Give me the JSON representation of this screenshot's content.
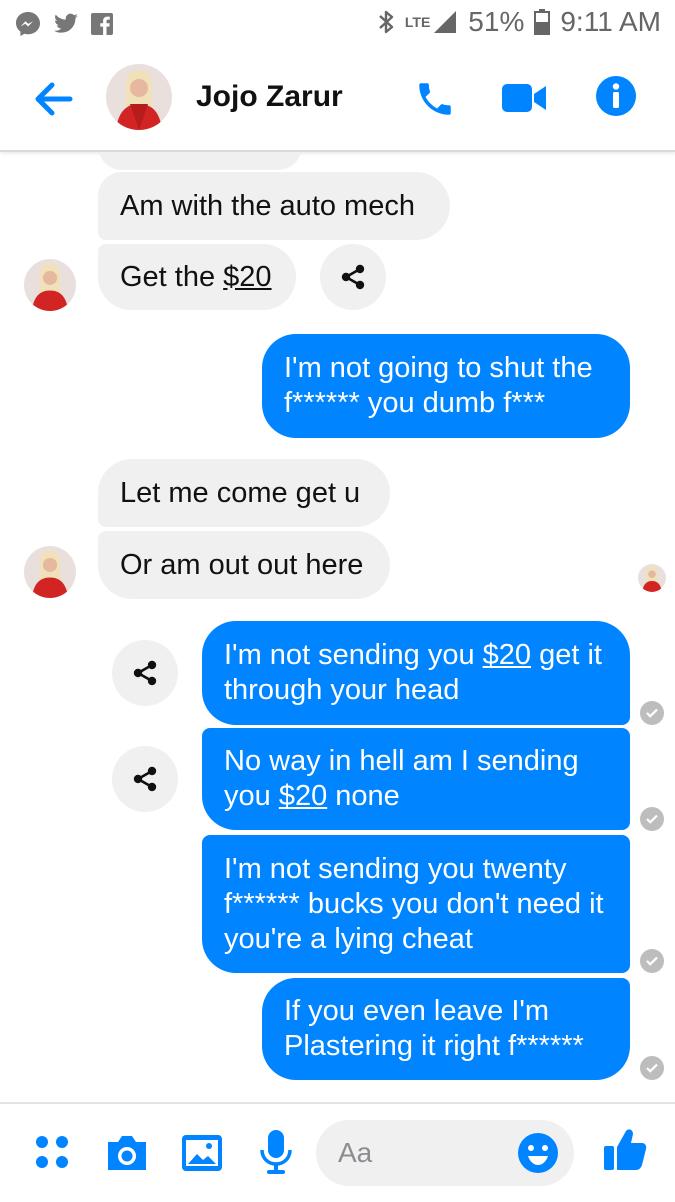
{
  "status_bar": {
    "network": "LTE",
    "battery": "51%",
    "time": "9:11 AM"
  },
  "header": {
    "contact_name": "Jojo Zarur"
  },
  "messages": [
    {
      "text": "Am with the auto mech"
    },
    {
      "pre": "Get the ",
      "link": "$20",
      "post": ""
    },
    {
      "text": "I'm not going to shut the f****** you dumb f***"
    },
    {
      "text": "Let me come get u"
    },
    {
      "text": "Or am out out here"
    },
    {
      "pre": "I'm not sending you ",
      "link": "$20",
      "post": " get it through your head"
    },
    {
      "pre": "No way in hell am I sending you ",
      "link": "$20",
      "post": " none"
    },
    {
      "text": "I'm not sending you twenty f****** bucks you don't need it you're a lying cheat"
    },
    {
      "text": "If you even leave I'm Plastering it right f******"
    }
  ],
  "composer": {
    "placeholder": "Aa"
  },
  "icons": {
    "status_left": [
      "messenger-icon",
      "twitter-icon",
      "facebook-icon"
    ],
    "status_right": [
      "bluetooth-icon",
      "signal-icon",
      "battery-icon"
    ],
    "header": [
      "back-arrow-icon",
      "phone-icon",
      "video-camera-icon",
      "info-icon"
    ],
    "composer": [
      "apps-grid-icon",
      "camera-icon",
      "gallery-icon",
      "microphone-icon",
      "emoji-icon",
      "thumbs-up-icon"
    ],
    "chat": [
      "share-icon",
      "seen-check-icon"
    ]
  },
  "colors": {
    "accent": "#0084ff",
    "incoming_bubble": "#f1f0f0",
    "outgoing_bubble": "#0084ff",
    "status_text": "#666666"
  }
}
